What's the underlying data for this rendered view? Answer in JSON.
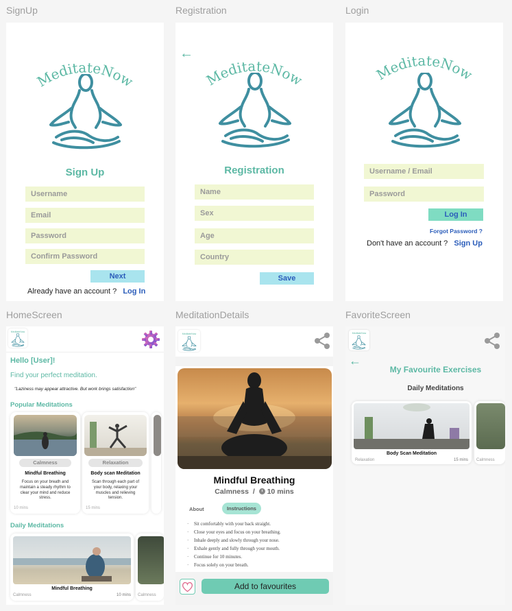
{
  "frames": {
    "signup": {
      "label": "SignUp",
      "logo_text": "MeditateNow",
      "heading": "Sign Up",
      "fields": [
        "Username",
        "Email",
        "Password",
        "Confirm Password"
      ],
      "next_label": "Next",
      "have_account": "Already have an account ?",
      "login_link": "Log In"
    },
    "registration": {
      "label": "Registration",
      "logo_text": "MeditateNow",
      "heading": "Registration",
      "fields": [
        "Name",
        "Sex",
        "Age",
        "Country"
      ],
      "save_label": "Save"
    },
    "login": {
      "label": "Login",
      "logo_text": "MeditateNow",
      "fields": [
        "Username / Email",
        "Password"
      ],
      "login_label": "Log In",
      "forgot": "Forgot Password ?",
      "no_account": "Don't have an account ?",
      "signup_link": "Sign Up"
    },
    "home": {
      "label": "HomeScreen",
      "mini_logo": "MeditateNow",
      "greeting": "Hello [User]!",
      "subtitle": "Find your perfect meditation.",
      "quote": "\"Laziness may appear attractive. But work brings satisfaction\"",
      "popular_title": "Popular Meditations",
      "popular": [
        {
          "chip": "Calmness",
          "title": "Mindful Breathing",
          "desc": "Focus on your breath and maintain a steady rhythm to clear your mind and reduce stress.",
          "time": "10 mins"
        },
        {
          "chip": "Relaxation",
          "title": "Body scan Meditation",
          "desc": "Scan through each part of your body, relaxing your muscles and relieving tension.",
          "time": "15 mins"
        }
      ],
      "daily_title": "Daily Meditations",
      "daily": [
        {
          "title": "Mindful Breathing",
          "chip": "Calmness",
          "time": "10 mins"
        },
        {
          "chip": "Calmness"
        }
      ]
    },
    "details": {
      "label": "MeditationDetails",
      "mini_logo": "MeditateNow",
      "title": "Mindful Breathing",
      "category": "Calmness",
      "separator": "/",
      "duration": "10 mins",
      "tab_about": "About",
      "tab_instructions": "Instructions",
      "instructions": [
        "Sit comfortably with your back straight.",
        "Close your eyes and focus on your breathing.",
        "Inhale deeply and slowly through your nose.",
        "Exhale gently and fully through your mouth.",
        "Continue for 10 minutes.",
        "Focus solely on your breath."
      ],
      "add_fav": "Add to favourites"
    },
    "favorite": {
      "label": "FavoriteScreen",
      "mini_logo": "MeditateNow",
      "title": "My Favourite Exercises",
      "subtitle": "Daily Meditations",
      "cards": [
        {
          "chip": "Relaxation",
          "title": "Body Scan Meditation",
          "time": "15 mins"
        },
        {
          "chip": "Calmness"
        }
      ]
    }
  },
  "colors": {
    "accent": "#5cb8a4",
    "field_bg": "#f1f7d3",
    "button_light": "#a9e4ee",
    "button_green": "#7fdcc2",
    "link": "#2b5dba"
  },
  "icons": [
    "back-arrow-icon",
    "share-icon",
    "gear-icon",
    "heart-icon",
    "clock-icon",
    "meditation-figure-icon"
  ]
}
